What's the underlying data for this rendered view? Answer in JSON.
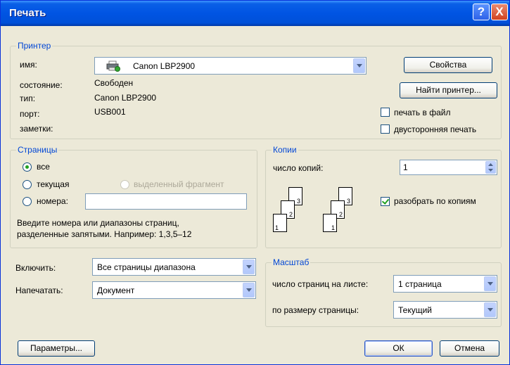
{
  "title": "Печать",
  "titlebar": {
    "help": "?",
    "close": "X"
  },
  "printer": {
    "legend": "Принтер",
    "name_label": "имя:",
    "name_value": "Canon LBP2900",
    "status_label": "состояние:",
    "status_value": "Свободен",
    "type_label": "тип:",
    "type_value": "Canon LBP2900",
    "port_label": "порт:",
    "port_value": "USB001",
    "notes_label": "заметки:",
    "properties_button": "Свойства",
    "find_button": "Найти принтер...",
    "print_to_file": "печать в файл",
    "duplex": "двусторонняя печать"
  },
  "pages": {
    "legend": "Страницы",
    "all": "все",
    "current": "текущая",
    "selection": "выделенный фрагмент",
    "numbers": "номера:",
    "hint_line1": "Введите номера или диапазоны страниц,",
    "hint_line2": "разделенные запятыми. Например: 1,3,5–12"
  },
  "copies": {
    "legend": "Копии",
    "count_label": "число копий:",
    "count_value": "1",
    "collate": "разобрать по копиям",
    "stack_labels": [
      "3",
      "2",
      "1"
    ]
  },
  "include": {
    "label": "Включить:",
    "value": "Все страницы диапазона"
  },
  "print_what": {
    "label": "Напечатать:",
    "value": "Документ"
  },
  "zoom": {
    "legend": "Масштаб",
    "pages_per_sheet_label": "число страниц на листе:",
    "pages_per_sheet_value": "1 страница",
    "scale_label": "по размеру страницы:",
    "scale_value": "Текущий"
  },
  "buttons": {
    "options": "Параметры...",
    "ok": "ОК",
    "cancel": "Отмена"
  }
}
